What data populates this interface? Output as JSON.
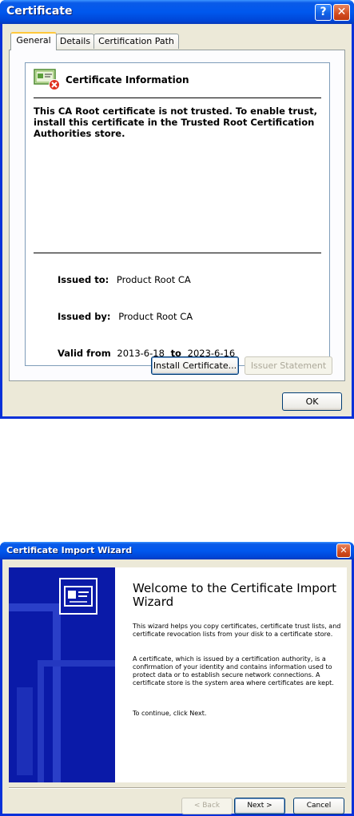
{
  "cert_dialog": {
    "title": "Certificate",
    "tabs": [
      "General",
      "Details",
      "Certification Path"
    ],
    "info_title": "Certificate Information",
    "warning": "This CA Root certificate is not trusted. To enable trust, install this certificate in the Trusted Root Certification Authorities store.",
    "issued_to_label": "Issued to:",
    "issued_to_value": "Product Root CA",
    "issued_by_label": "Issued by:",
    "issued_by_value": "Product Root CA",
    "valid_from_label": "Valid from",
    "valid_from_value": "2013-6-18",
    "valid_to_label": "to",
    "valid_to_value": "2023-6-16",
    "install_button": "Install Certificate...",
    "issuer_statement_button": "Issuer Statement",
    "ok_button": "OK",
    "help_glyph": "?",
    "close_glyph": "✕"
  },
  "wizard": {
    "title": "Certificate Import Wizard",
    "heading": "Welcome to the Certificate Import Wizard",
    "para1": "This wizard helps you copy certificates, certificate trust lists, and certificate revocation lists from your disk to a certificate store.",
    "para2": "A certificate, which is issued by a certification authority, is a confirmation of your identity and contains information used to protect data or to establish secure network connections. A certificate store is the system area where certificates are kept.",
    "para3": "To continue, click Next.",
    "back_button": "< Back",
    "next_button": "Next >",
    "cancel_button": "Cancel",
    "close_glyph": "✕"
  },
  "colors": {
    "title_bar": "#0058ee",
    "dialog_face": "#ece9d8",
    "wizard_sidebar": "#0a1aa8",
    "error_badge": "#e0301e"
  },
  "icons": {
    "certificate": "certificate-error-icon",
    "wizard_certificate": "wizard-certificate-icon"
  }
}
